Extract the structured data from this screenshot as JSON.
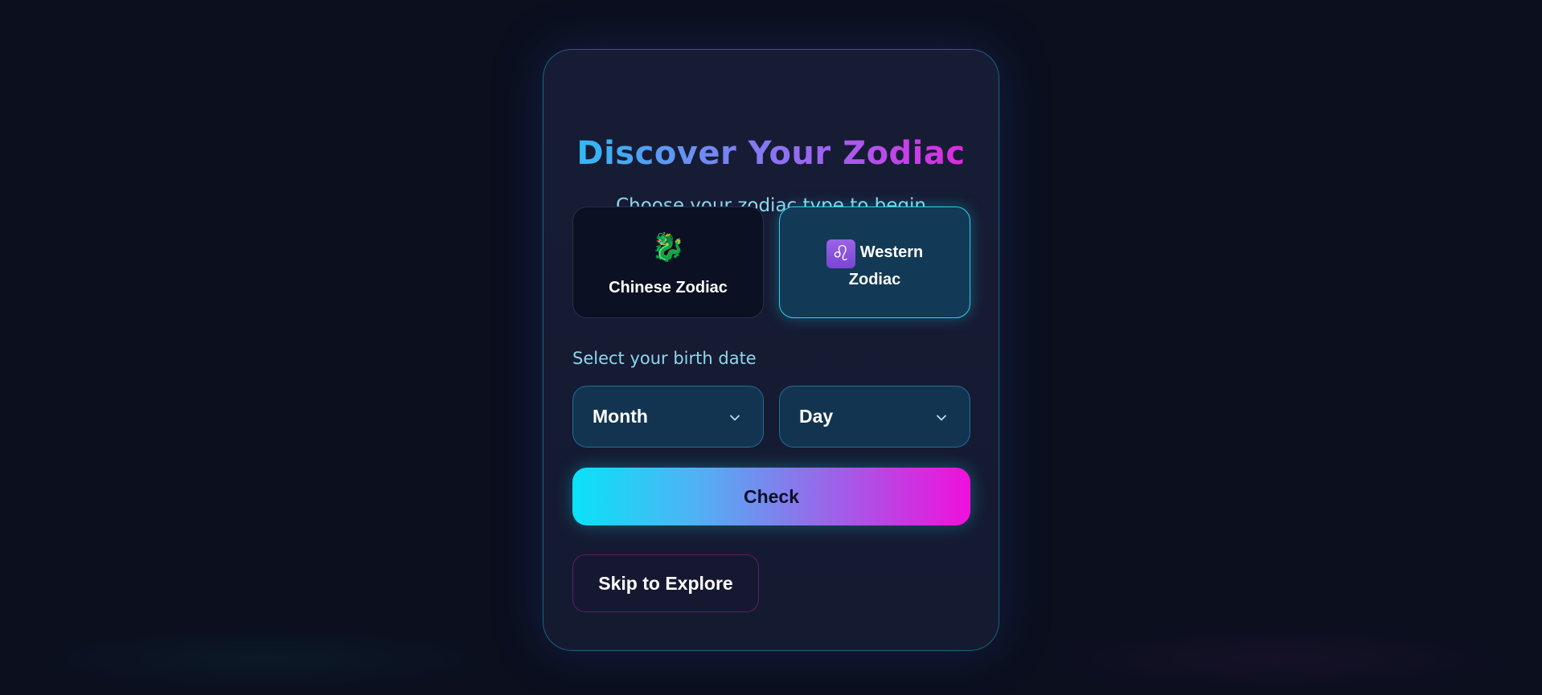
{
  "header": {
    "title": "Discover Your Zodiac",
    "subtitle": "Choose your zodiac type to begin"
  },
  "zodiac_types": {
    "chinese": {
      "icon": "dragon-icon",
      "glyph": "🐉",
      "label": "Chinese Zodiac",
      "selected": false
    },
    "western": {
      "icon": "leo-icon",
      "glyph": "♌",
      "label_line1": "Western",
      "label_line2": "Zodiac",
      "selected": true
    }
  },
  "birth_date": {
    "label": "Select your birth date",
    "month": {
      "value": "Month"
    },
    "day": {
      "value": "Day"
    }
  },
  "actions": {
    "check_label": "Check",
    "skip_label": "Skip to Explore"
  },
  "colors": {
    "accent_cyan": "#2ad1ee",
    "accent_magenta": "#f010dc",
    "background": "#0b0f1e"
  }
}
